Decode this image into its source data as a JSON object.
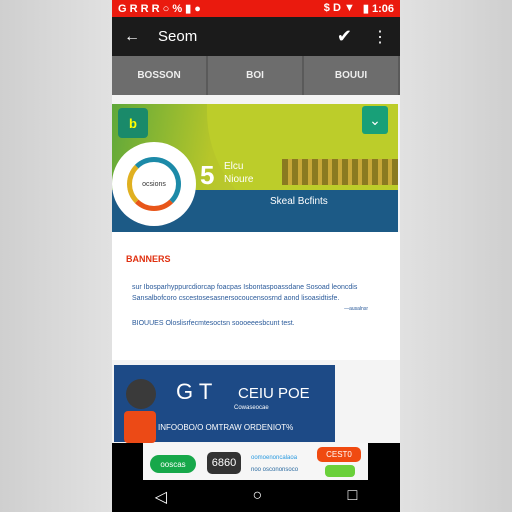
{
  "status_bar": {
    "left": "G R R R ○ % ▮ ●",
    "right_icons": "$ D ▼",
    "time": "▮ 1:06",
    "color": "#ea1a0e"
  },
  "toolbar": {
    "back": "←",
    "title": "Seom",
    "confirm": "✔",
    "more": "⋮"
  },
  "tabs": [
    "BOSSON",
    "BOI",
    "BOUUI"
  ],
  "card": {
    "badge": "b",
    "ring_text": "ocsions",
    "number": "5",
    "subtitle_1": "Elcu",
    "subtitle_2": "Nioure",
    "dropdown": "⌄",
    "band_text": "Skeal Bcfints"
  },
  "content": {
    "heading": "BANNERS",
    "paragraph": "sur Ibosparhyppurcdiorcap foacpas Isbontaspoassdane Sosoad leoncdis Sansalbofcoro cscestosesasnersocoucensosrnd aond lisoasidtisfe.",
    "link": "—ausalnsr",
    "paragraph2": "BIOUUES Oloslisrfecmtesoctsn soooeeesbcunt test."
  },
  "banner": {
    "logo": "G T",
    "title": "CEIU POE",
    "tagline": "Cowaseocae",
    "text": "INFOOBO/O OMTRAW ORDENIOT%"
  },
  "ad": {
    "button": "ooscas",
    "logo": "6860",
    "line1": "oomoenoncalaoa",
    "line2": "noo oscononsoco",
    "cta": "CEST0"
  },
  "nav": {
    "back": "◁",
    "home": "○",
    "recents": "□"
  }
}
